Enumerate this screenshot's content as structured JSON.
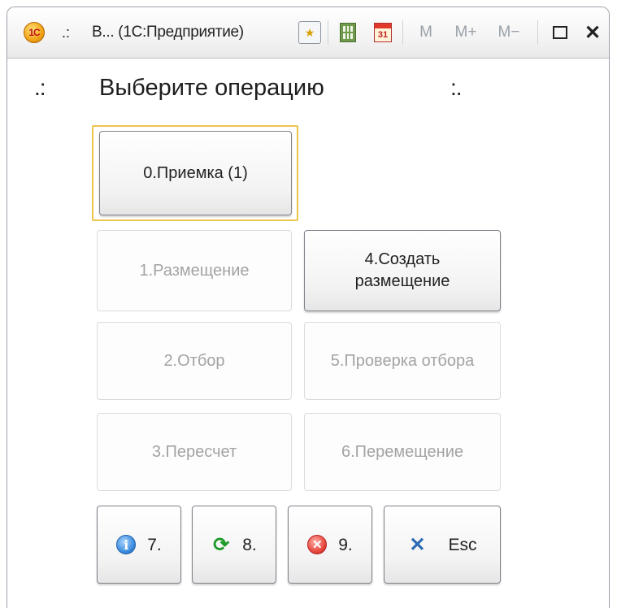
{
  "window": {
    "dots": ".:",
    "title": "В... (1С:Предприятие)",
    "calendar_day": "31",
    "memory_buttons": [
      "M",
      "M+",
      "M−"
    ],
    "close_glyph": "✕"
  },
  "form": {
    "marker_left": ".:",
    "heading": "Выберите операцию",
    "marker_right": ":."
  },
  "operations": [
    {
      "label": "0.Приемка (1)",
      "enabled": true,
      "focused": true
    },
    {
      "label": "1.Размещение",
      "enabled": false
    },
    {
      "label": "4.Создать\nразмещение",
      "enabled": true
    },
    {
      "label": "2.Отбор",
      "enabled": false
    },
    {
      "label": "5.Проверка отбора",
      "enabled": false
    },
    {
      "label": "3.Пересчет",
      "enabled": false
    },
    {
      "label": "6.Перемещение",
      "enabled": false
    }
  ],
  "tool_buttons": [
    {
      "label": "7.",
      "icon": "info-icon"
    },
    {
      "label": "8.",
      "icon": "refresh-icon"
    },
    {
      "label": "9.",
      "icon": "stop-icon"
    },
    {
      "label": "Esc",
      "icon": "close-icon"
    }
  ],
  "colors": {
    "focus_border": "#ecc54a",
    "disabled_text": "#a3a3a3",
    "info_blue": "#3f8ee0",
    "refresh_green": "#1f9a2a",
    "stop_red": "#e84a40"
  }
}
